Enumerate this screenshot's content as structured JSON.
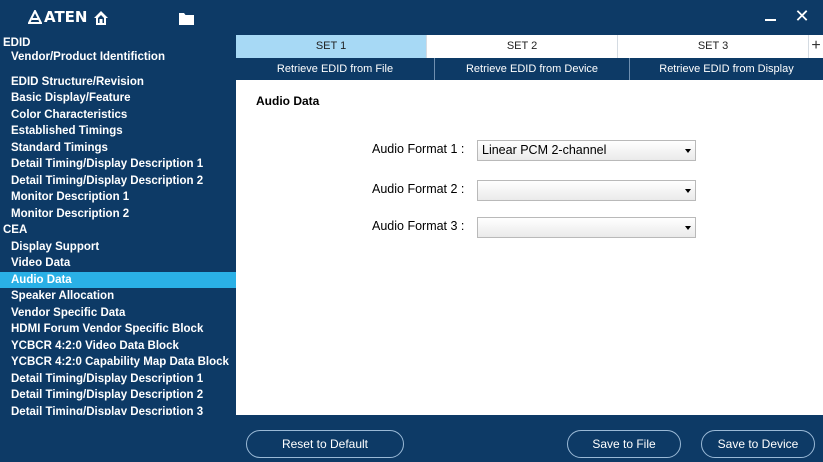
{
  "titlebar": {
    "logo_text": "ATEN",
    "icons": [
      "home-icon",
      "folder-icon",
      "minimize-icon",
      "close-icon"
    ],
    "close_glyph": "✕"
  },
  "sidebar": {
    "items": [
      {
        "label": "EDID",
        "type": "section"
      },
      {
        "label": "Vendor/Product Identifiction",
        "type": "item"
      },
      {
        "label": "EDID Structure/Revision",
        "type": "item"
      },
      {
        "label": "Basic Display/Feature",
        "type": "item"
      },
      {
        "label": "Color Characteristics",
        "type": "item"
      },
      {
        "label": "Established Timings",
        "type": "item"
      },
      {
        "label": "Standard Timings",
        "type": "item"
      },
      {
        "label": "Detail Timing/Display Description 1",
        "type": "item"
      },
      {
        "label": "Detail Timing/Display Description 2",
        "type": "item"
      },
      {
        "label": "Monitor Description 1",
        "type": "item"
      },
      {
        "label": "Monitor Description 2",
        "type": "item"
      },
      {
        "label": "CEA",
        "type": "section"
      },
      {
        "label": "Display Support",
        "type": "item"
      },
      {
        "label": "Video Data",
        "type": "item"
      },
      {
        "label": "Audio Data",
        "type": "item",
        "active": true
      },
      {
        "label": "Speaker Allocation",
        "type": "item"
      },
      {
        "label": "Vendor Specific Data",
        "type": "item"
      },
      {
        "label": "HDMI Forum Vendor Specific Block",
        "type": "item"
      },
      {
        "label": "YCBCR 4:2:0 Video Data Block",
        "type": "item"
      },
      {
        "label": "YCBCR 4:2:0 Capability Map Data Block",
        "type": "item"
      },
      {
        "label": "Detail Timing/Display Description 1",
        "type": "item"
      },
      {
        "label": "Detail Timing/Display Description 2",
        "type": "item"
      },
      {
        "label": "Detail Timing/Display Description 3",
        "type": "item"
      }
    ]
  },
  "tabs": {
    "sets": [
      "SET 1",
      "SET 2",
      "SET 3"
    ],
    "active_index": 0,
    "add_label": "+"
  },
  "retrieve": {
    "file": "Retrieve EDID from File",
    "device": "Retrieve EDID from Device",
    "display": "Retrieve EDID from Display"
  },
  "main": {
    "title": "Audio Data",
    "fields": [
      {
        "label": "Audio Format 1 :",
        "value": "Linear PCM 2-channel"
      },
      {
        "label": "Audio Format 2 :",
        "value": ""
      },
      {
        "label": "Audio Format 3 :",
        "value": ""
      }
    ]
  },
  "footer": {
    "reset": "Reset to Default",
    "save_file": "Save to File",
    "save_device": "Save to Device"
  },
  "colors": {
    "navy": "#0d3a66",
    "active_item": "#2ab0e6",
    "active_tab": "#a7d9f5"
  }
}
